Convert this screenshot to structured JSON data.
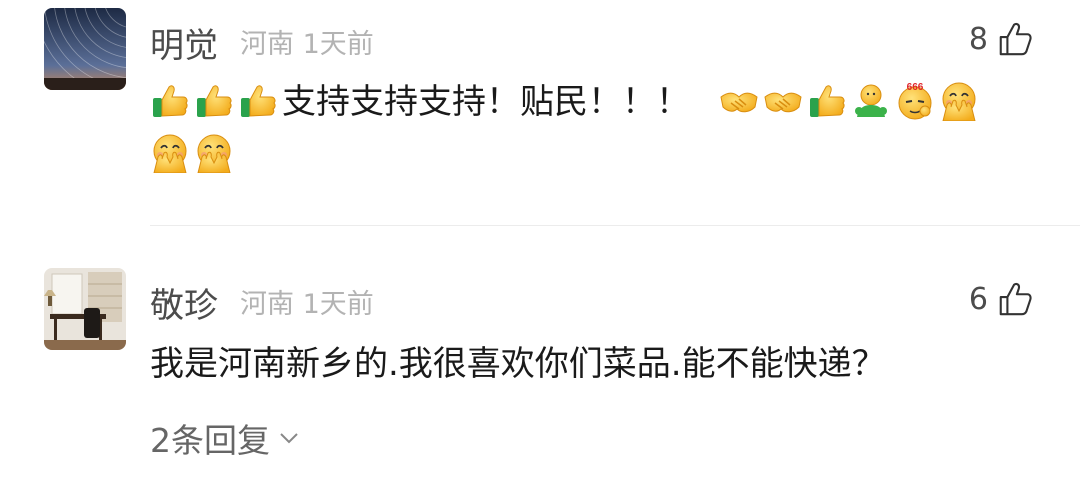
{
  "comments": [
    {
      "author": "明觉",
      "location": "河南",
      "time": "1天前",
      "likes": "8",
      "text": "支持支持支持！贴民！！！",
      "leading_emojis": [
        "thumbs-up-icon",
        "thumbs-up-icon",
        "thumbs-up-icon"
      ],
      "trailing_emojis": [
        "handshake-icon",
        "handshake-icon",
        "thumbs-up-icon",
        "green-sprout-icon",
        "666-face-icon",
        "facepalm-smile-icon",
        "facepalm-smile-icon",
        "facepalm-smile-icon"
      ]
    },
    {
      "author": "敬珍",
      "location": "河南",
      "time": "1天前",
      "likes": "6",
      "text": "我是河南新乡的.我很喜欢你们菜品.能不能快递？",
      "replies": "2条回复"
    }
  ],
  "colors": {
    "name": "#4c4c4c",
    "meta": "#b3b3b3",
    "text": "#1a1a1a",
    "emoji_yellow": "#f7c33a"
  }
}
